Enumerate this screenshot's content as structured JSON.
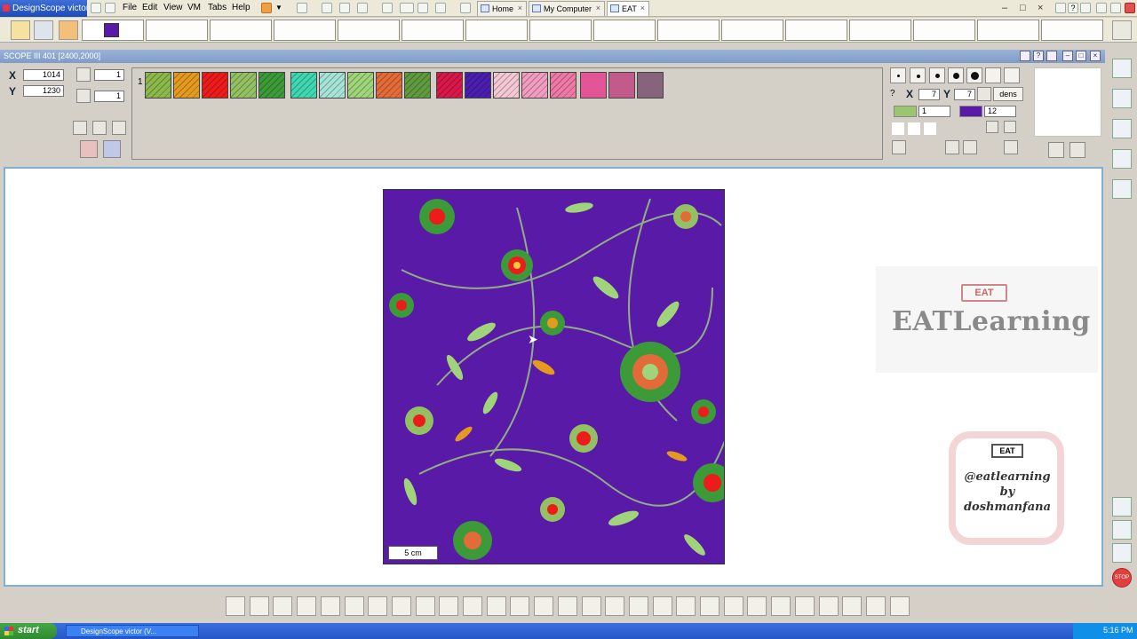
{
  "titlebar": {
    "app_title": "DesignScope victor",
    "menu": [
      "File",
      "Edit",
      "View",
      "VM",
      "Tabs",
      "Help"
    ],
    "tabs": [
      {
        "label": "Home",
        "close": "×"
      },
      {
        "label": "My Computer",
        "close": "×"
      },
      {
        "label": "EAT",
        "close": "×"
      }
    ],
    "window_controls": [
      "–",
      "□",
      "×"
    ]
  },
  "scope": {
    "title": "SCOPE III 401 [2400,2000]"
  },
  "coords": {
    "x_label": "X",
    "y_label": "Y",
    "x_value": "1014",
    "y_value": "1230",
    "x_step": "1",
    "y_step": "1"
  },
  "palette": {
    "index_label": "1",
    "swatches": [
      {
        "color": "#8ab84a",
        "hatched": true
      },
      {
        "color": "#e39a1f",
        "hatched": true
      },
      {
        "color": "#ee1b1b",
        "hatched": true
      },
      {
        "color": "#93c062",
        "hatched": true
      },
      {
        "color": "#3c9a38",
        "hatched": true
      },
      {
        "color": "#3fd6b0",
        "hatched": true
      },
      {
        "color": "#a6e2d6",
        "hatched": true
      },
      {
        "color": "#9fd47b",
        "hatched": true
      },
      {
        "color": "#e36b3a",
        "hatched": true
      },
      {
        "color": "#5f9a3e",
        "hatched": true
      },
      {
        "color": "#d8184a",
        "hatched": true
      },
      {
        "color": "#4a1fb0",
        "hatched": true
      },
      {
        "color": "#f4c7d4",
        "hatched": true
      },
      {
        "color": "#f19cc0",
        "hatched": true
      },
      {
        "color": "#ec7aa5",
        "hatched": true
      },
      {
        "color": "#e35596",
        "hatched": false
      },
      {
        "color": "#c25b8a",
        "hatched": false
      },
      {
        "color": "#86647c",
        "hatched": false
      }
    ]
  },
  "right_panel": {
    "x_label": "X",
    "y_label": "Y",
    "x_value": "7",
    "y_value": "7",
    "dens_label": "dens",
    "color1": "#9cc56f",
    "color1_value": "1",
    "color2": "#5a1aa8",
    "color2_value": "12"
  },
  "canvas": {
    "background_color": "#5a1aa8",
    "scale_label": "5 cm"
  },
  "watermarks": {
    "logo_text": "EAT",
    "brand": "EATLearning",
    "social_lines": [
      "@eatlearning",
      "by",
      "doshmanfana"
    ]
  },
  "taskbar": {
    "start_label": "start",
    "task_label": "DesignScope victor (V...",
    "clock": "5:16 PM"
  }
}
